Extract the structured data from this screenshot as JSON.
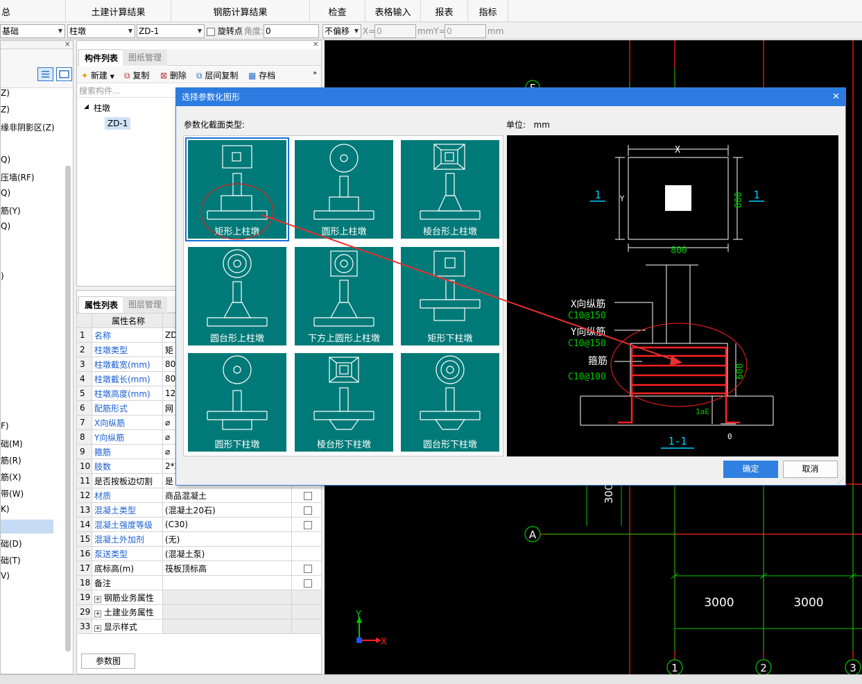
{
  "menu": {
    "items": [
      "总",
      "土建计算结果",
      "钢筋计算结果",
      "检查",
      "表格输入",
      "报表",
      "指标"
    ]
  },
  "toolbar": {
    "floor": "基础",
    "category": "柱墩",
    "component": "ZD-1",
    "rotate_label": "旋转点",
    "angle_label": "角度:",
    "angle_value": "0",
    "offset": "不偏移",
    "x_label": "X=",
    "x_value": "0",
    "y_label": "mmY=",
    "y_value": "0",
    "unit": "mm"
  },
  "left_nav": {
    "items": [
      "Z)",
      "Z)",
      "缘非阴影区(Z)",
      "Q)",
      "压墙(RF)",
      "Q)",
      "筋(Y)",
      "Q)",
      ")",
      "F)",
      "础(M)",
      "筋(R)",
      "筋(X)",
      "带(W)",
      "K)",
      "础(D)",
      "础(T)",
      "V)"
    ]
  },
  "component_panel": {
    "tabs": [
      "构件列表",
      "图纸管理"
    ],
    "actions": {
      "new": "新建",
      "copy": "复制",
      "delete": "删除",
      "floor_copy": "层间复制",
      "save": "存档"
    },
    "search_placeholder": "搜索构件...",
    "tree_root": "柱墩",
    "tree_child": "ZD-1"
  },
  "property_panel": {
    "tabs": [
      "属性列表",
      "图层管理"
    ],
    "header": "属性名称",
    "rows": [
      {
        "num": "1",
        "name": "名称",
        "value": "ZD"
      },
      {
        "num": "2",
        "name": "柱墩类型",
        "value": "矩"
      },
      {
        "num": "3",
        "name": "柱墩截宽(mm)",
        "value": "80"
      },
      {
        "num": "4",
        "name": "柱墩截长(mm)",
        "value": "80"
      },
      {
        "num": "5",
        "name": "柱墩高度(mm)",
        "value": "12"
      },
      {
        "num": "6",
        "name": "配筋形式",
        "value": "网"
      },
      {
        "num": "7",
        "name": "X向纵筋",
        "value": "⌀"
      },
      {
        "num": "8",
        "name": "Y向纵筋",
        "value": "⌀"
      },
      {
        "num": "9",
        "name": "箍筋",
        "value": "⌀"
      },
      {
        "num": "10",
        "name": "肢数",
        "value": "2*2"
      },
      {
        "num": "11",
        "name": "是否按板边切割",
        "value": "是"
      },
      {
        "num": "12",
        "name": "材质",
        "value": "商品混凝土"
      },
      {
        "num": "13",
        "name": "混凝土类型",
        "value": "(混凝土20石)"
      },
      {
        "num": "14",
        "name": "混凝土强度等级",
        "value": "(C30)"
      },
      {
        "num": "15",
        "name": "混凝土外加剂",
        "value": "(无)"
      },
      {
        "num": "16",
        "name": "泵送类型",
        "value": "(混凝土泵)"
      },
      {
        "num": "17",
        "name": "底标高(m)",
        "value": "筏板顶标高"
      },
      {
        "num": "18",
        "name": "备注",
        "value": ""
      },
      {
        "num": "19",
        "name": "钢筋业务属性",
        "value": ""
      },
      {
        "num": "29",
        "name": "土建业务属性",
        "value": ""
      },
      {
        "num": "33",
        "name": "显示样式",
        "value": ""
      }
    ],
    "param_button": "参数图"
  },
  "dialog": {
    "title": "选择参数化图形",
    "section_label": "参数化截面类型:",
    "unit_label": "单位:",
    "unit_value": "mm",
    "tiles": [
      "矩形上柱墩",
      "圆形上柱墩",
      "棱台形上柱墩",
      "圆台形上柱墩",
      "下方上圆形上柱墩",
      "矩形下柱墩",
      "圆形下柱墩",
      "棱台形下柱墩",
      "圆台形下柱墩"
    ],
    "preview": {
      "dim_x": "X",
      "dim_y": "Y",
      "dim_800_h": "800",
      "dim_800_v": "800",
      "section_mark": "1",
      "x_rebar": "X向纵筋",
      "x_rebar_spec": "C10@150",
      "y_rebar": "Y向纵筋",
      "y_rebar_spec": "C10@150",
      "stirrup": "箍筋",
      "stirrup_spec": "C10@100",
      "height_600": "600",
      "lae": "1aE",
      "zero": "0",
      "section_title": "1-1"
    },
    "ok": "确定",
    "cancel": "取消"
  },
  "cad": {
    "axis_labels": [
      "A",
      "1",
      "2",
      "3"
    ],
    "axis_f": "F",
    "dims": [
      "3000",
      "3000"
    ],
    "dim_300": "300",
    "ucs_x": "X",
    "ucs_y": "Y"
  },
  "colors": {
    "tile_teal": "#007a78",
    "accent_blue": "#2b7be0",
    "cad_red": "#ff2020",
    "cad_green": "#00c800",
    "cad_cyan": "#00d0ff"
  }
}
